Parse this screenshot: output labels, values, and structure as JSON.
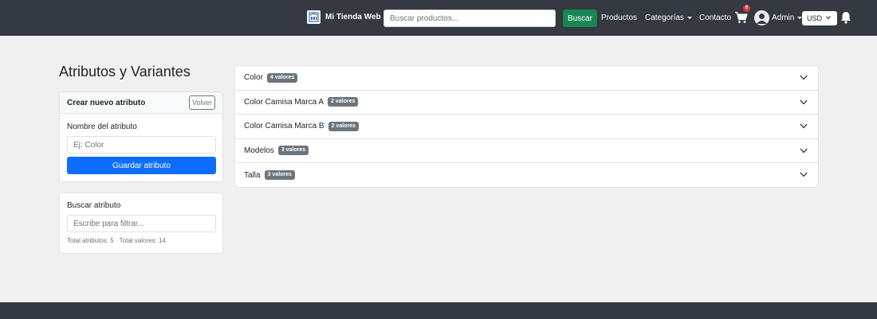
{
  "navbar": {
    "brand": "Mi Tienda Web",
    "search_placeholder": "Buscar productos...",
    "search_button": "Buscar",
    "links": {
      "productos": "Productos",
      "categorias": "Categorías",
      "contacto": "Contacto",
      "admin": "Admin"
    },
    "cart_count": "0",
    "currency": "USD"
  },
  "page": {
    "title": "Atributos y Variantes"
  },
  "create_card": {
    "header": "Crear nuevo atributo",
    "back_button": "Volver",
    "name_label": "Nombre del atributo",
    "name_placeholder": "Ej: Color",
    "save_button": "Guardar atributo"
  },
  "search_card": {
    "label": "Buscar atributo",
    "placeholder": "Escribe para filtrar...",
    "totals": "Total atributos: 5 · Total valores: 14"
  },
  "attributes": [
    {
      "name": "Color",
      "badge": "4 valores"
    },
    {
      "name": "Color Camisa Marca A",
      "badge": "2 valores"
    },
    {
      "name": "Color Camisa Marca B",
      "badge": "2 valores"
    },
    {
      "name": "Modelos",
      "badge": "3 valores"
    },
    {
      "name": "Talla",
      "badge": "3 valores"
    }
  ],
  "colors": {
    "navbar": "#343a40",
    "search_button": "#198754",
    "primary": "#0d6efd",
    "badge": "#6c757d",
    "cart_badge": "#dc3545"
  }
}
